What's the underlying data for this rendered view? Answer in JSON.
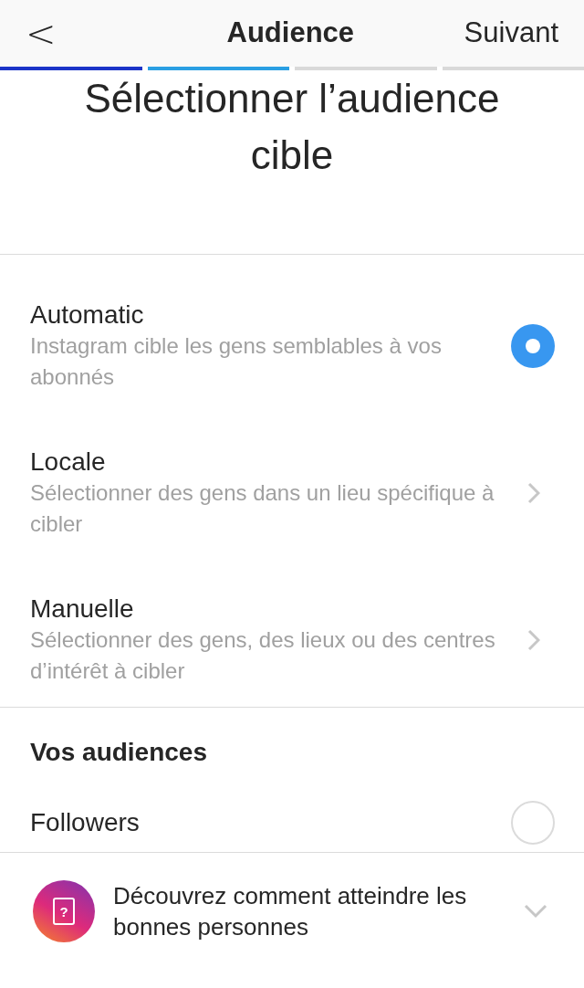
{
  "nav": {
    "back": "<",
    "title": "Audience",
    "next": "Suivant"
  },
  "progress": [
    {
      "color": "#1c34c8"
    },
    {
      "color": "#2a9fe3"
    },
    {
      "color": "#d9d9d9"
    },
    {
      "color": "#d9d9d9"
    }
  ],
  "heading": "Sélectionner l’audience cible",
  "options": [
    {
      "kind": "radio",
      "title": "Automatic",
      "subtitle": "Instagram cible les gens semblables à vos abonnés",
      "selected": true
    },
    {
      "kind": "link",
      "title": "Locale",
      "subtitle": "Sélectionner des gens dans un lieu spécifique à cibler"
    },
    {
      "kind": "link",
      "title": "Manuelle",
      "subtitle": "Sélectionner des gens, des lieux ou des centres d’intérêt à cibler"
    }
  ],
  "audiences": {
    "title": "Vos audiences",
    "items": [
      {
        "title": "Followers",
        "selected": false
      }
    ]
  },
  "guide": {
    "icon_glyph": "?",
    "text": "Découvrez comment atteindre les bonnes personnes",
    "expanded": false
  }
}
